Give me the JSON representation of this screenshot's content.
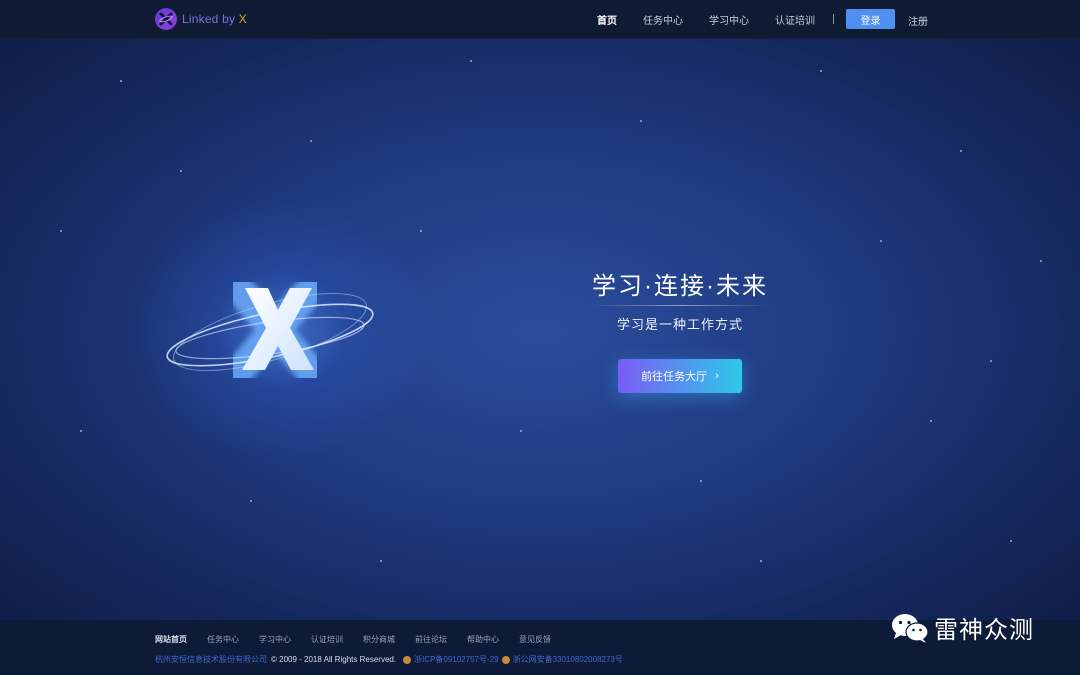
{
  "header": {
    "logo_text": "Linked by ",
    "logo_accent": "X",
    "nav": [
      {
        "label": "首页",
        "active": true
      },
      {
        "label": "任务中心",
        "active": false
      },
      {
        "label": "学习中心",
        "active": false
      },
      {
        "label": "认证培训",
        "active": false
      }
    ],
    "login_label": "登录",
    "register_label": "注册"
  },
  "hero": {
    "title": "学习·连接·未来",
    "subtitle": "学习是一种工作方式",
    "cta_label": "前往任务大厅",
    "cta_chevron": "›"
  },
  "footer": {
    "links": [
      {
        "label": "网站首页",
        "active": true
      },
      {
        "label": "任务中心",
        "active": false
      },
      {
        "label": "学习中心",
        "active": false
      },
      {
        "label": "认证培训",
        "active": false
      },
      {
        "label": "积分商城",
        "active": false
      },
      {
        "label": "前往论坛",
        "active": false
      },
      {
        "label": "帮助中心",
        "active": false
      },
      {
        "label": "意见反馈",
        "active": false
      }
    ],
    "company": "杭州安恒信息技术股份有限公司",
    "copyright": "© 2009 - 2018   All Rights Reserved.",
    "icp": "浙ICP备09102757号-29",
    "police": "浙公网安备33010802008273号"
  },
  "watermark": {
    "text": "雷神众测",
    "icon": "wechat-icon"
  },
  "colors": {
    "primary_button": "#4f8ff0",
    "cta_gradient_start": "#7a5cf6",
    "cta_gradient_end": "#2ec9e8",
    "logo_accent": "#d9a23a"
  }
}
